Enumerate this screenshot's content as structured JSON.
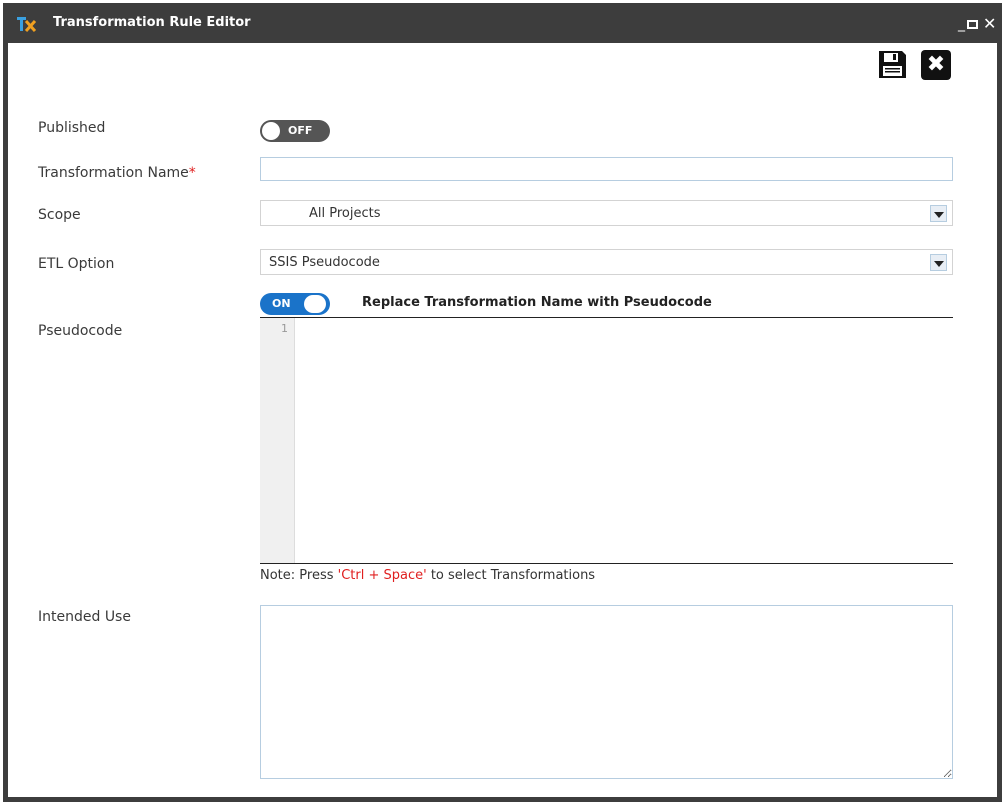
{
  "window": {
    "title": "Transformation Rule Editor",
    "minimize_glyph": "_",
    "close_glyph": "✕"
  },
  "toolbar": {
    "save_icon": "floppy-disk-icon",
    "close_icon": "close-icon",
    "close_glyph": "✖"
  },
  "form": {
    "published": {
      "label": "Published",
      "toggle_text": "OFF",
      "state": false
    },
    "transformation_name": {
      "label": "Transformation Name",
      "required_mark": "*",
      "value": ""
    },
    "scope": {
      "label": "Scope",
      "selected": "All Projects"
    },
    "etl_option": {
      "label": "ETL Option",
      "selected": "SSIS Pseudocode"
    },
    "replace_toggle": {
      "toggle_text": "ON",
      "state": true,
      "label": "Replace Transformation Name with Pseudocode"
    },
    "pseudocode": {
      "label": "Pseudocode",
      "line_number": "1",
      "value": ""
    },
    "note": {
      "prefix": "Note: Press ",
      "highlight": "'Ctrl + Space'",
      "suffix": " to select Transformations"
    },
    "intended_use": {
      "label": "Intended Use",
      "value": ""
    }
  },
  "colors": {
    "title_bar": "#3d3d3d",
    "toggle_on": "#1a73c9",
    "toggle_off": "#555555",
    "required": "#e02020",
    "note_highlight": "#e02020"
  }
}
